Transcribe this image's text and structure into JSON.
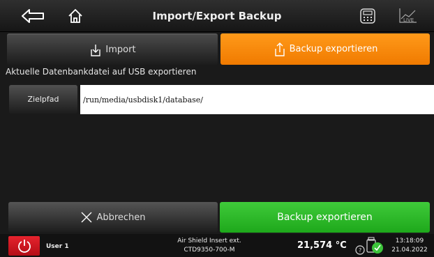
{
  "header": {
    "title": "Import/Export Backup",
    "icons": [
      "back-arrow-icon",
      "home-icon",
      "calculator-icon",
      "live-chart-icon"
    ],
    "live_label": "LIVE"
  },
  "tabs": {
    "import_label": "Import",
    "export_label": "Backup exportieren",
    "active": "export",
    "active_color": "#f58a0c"
  },
  "info_text": "Aktuelle Datenbankdatei auf USB exportieren",
  "path": {
    "button_label": "Zielpfad",
    "value": "/run/media/usbdisk1/database/"
  },
  "actions": {
    "cancel_label": "Abbrechen",
    "export_label": "Backup exportieren",
    "export_color": "#2db82a"
  },
  "status": {
    "user": "User 1",
    "device_line1": "Air Shield Insert ext.",
    "device_line2": "CTD9350-700-M",
    "temperature": "21,574 °C",
    "time": "13:18:09",
    "date": "21.04.2022",
    "power_color": "#d9141e"
  }
}
